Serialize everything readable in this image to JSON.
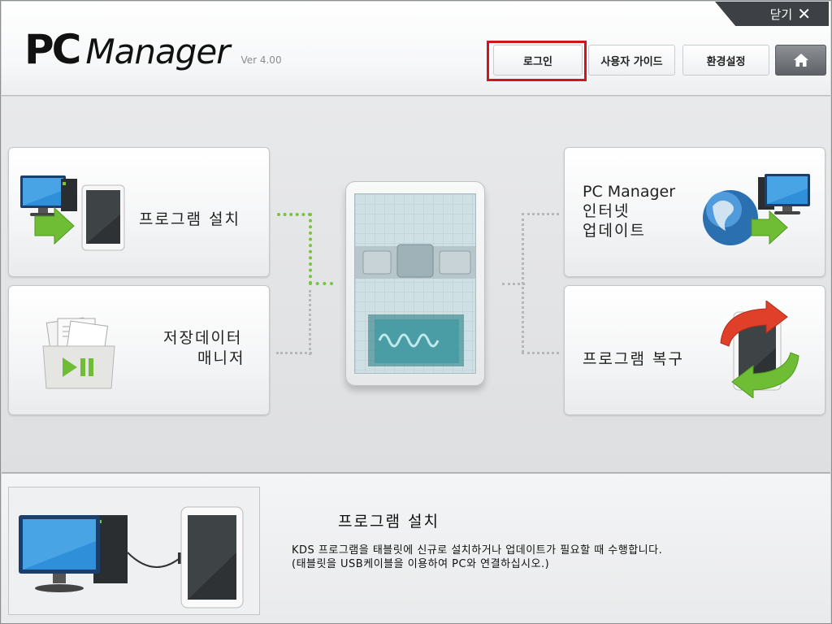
{
  "header": {
    "logo_pc": "PC",
    "logo_manager": "Manager",
    "version": "Ver 4.00",
    "close_label": "닫기",
    "buttons": {
      "login": "로그인",
      "user_guide": "사용자 가이드",
      "settings": "환경설정"
    },
    "home_icon": "home-icon"
  },
  "cards": {
    "install": {
      "label": "프로그램 설치",
      "icon": "pc-to-tablet-icon"
    },
    "storage": {
      "label_line1": "저장데이터",
      "label_line2": "매니저",
      "icon": "folder-play-icon"
    },
    "update": {
      "label_line1": "PC Manager",
      "label_line2": "인터넷",
      "label_line3": "업데이트",
      "icon": "globe-pc-icon"
    },
    "recovery": {
      "label": "프로그램 복구",
      "icon": "tablet-refresh-icon"
    }
  },
  "info": {
    "title": "프로그램 설치",
    "desc_line1": "KDS 프로그램을 태블릿에 신규로 설치하거나 업데이트가 필요할 때 수행합니다.",
    "desc_line2": "(태블릿을 USB케이블을  이용하여 PC와 연결하십시오.)"
  },
  "colors": {
    "highlight": "#d2141e",
    "accent_green": "#7cc242",
    "close_tab_bg": "#3d4145"
  }
}
